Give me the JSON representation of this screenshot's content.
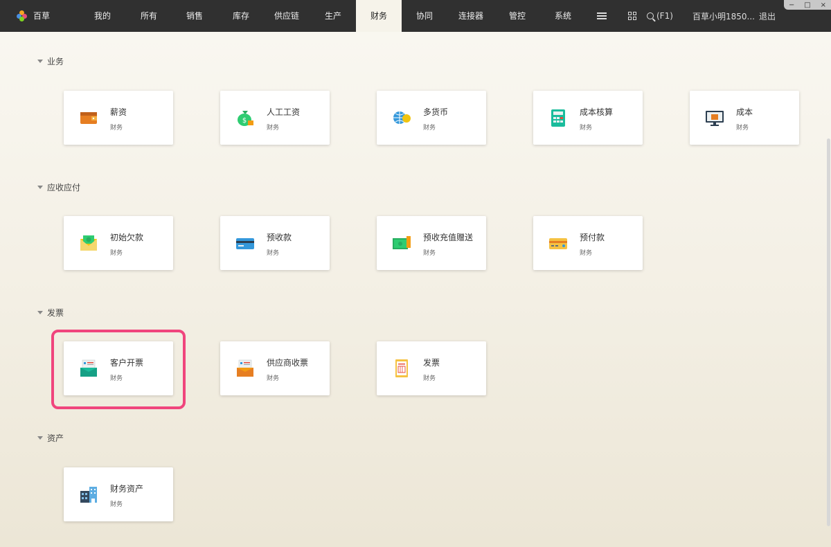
{
  "app": {
    "logo_text": "百草",
    "nav": [
      "我的",
      "所有",
      "销售",
      "库存",
      "供应链",
      "生产",
      "财务",
      "协同",
      "连接器",
      "管控",
      "系统"
    ],
    "active_nav": "财务",
    "search_hint": "(F1)",
    "user": "百草小明1850...",
    "logout": "退出",
    "window_controls": [
      "−",
      "□",
      "×"
    ]
  },
  "sections": [
    {
      "title": "业务",
      "cards": [
        {
          "name": "薪资",
          "sub": "财务",
          "icon": "wallet-icon"
        },
        {
          "name": "人工工资",
          "sub": "财务",
          "icon": "money-bag-icon"
        },
        {
          "name": "多货币",
          "sub": "财务",
          "icon": "globe-coin-icon"
        },
        {
          "name": "成本核算",
          "sub": "财务",
          "icon": "calculator-icon"
        },
        {
          "name": "成本",
          "sub": "财务",
          "icon": "monitor-box-icon"
        }
      ]
    },
    {
      "title": "应收应付",
      "cards": [
        {
          "name": "初始欠款",
          "sub": "财务",
          "icon": "envelope-money-icon"
        },
        {
          "name": "预收款",
          "sub": "财务",
          "icon": "credit-card-icon"
        },
        {
          "name": "预收充值赠送",
          "sub": "财务",
          "icon": "cash-stack-icon"
        },
        {
          "name": "预付款",
          "sub": "财务",
          "icon": "card-yellow-icon"
        }
      ]
    },
    {
      "title": "发票",
      "cards": [
        {
          "name": "客户开票",
          "sub": "财务",
          "icon": "invoice-green-icon"
        },
        {
          "name": "供应商收票",
          "sub": "财务",
          "icon": "invoice-orange-icon"
        },
        {
          "name": "发票",
          "sub": "财务",
          "icon": "receipt-icon"
        }
      ]
    },
    {
      "title": "资产",
      "cards": [
        {
          "name": "财务资产",
          "sub": "财务",
          "icon": "building-icon"
        }
      ]
    }
  ],
  "colors": {
    "topbar": "#303030",
    "highlight": "#f0457d",
    "card_bg": "#ffffff"
  }
}
